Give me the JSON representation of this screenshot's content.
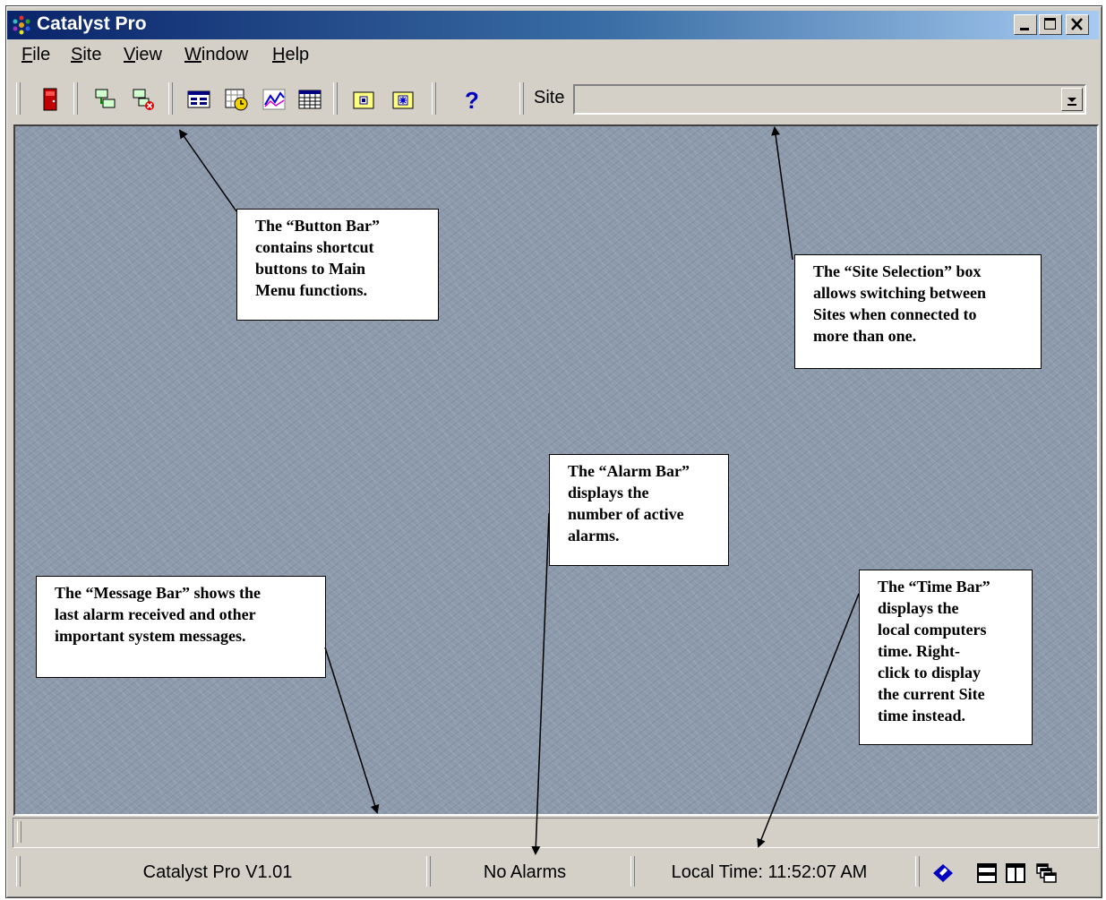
{
  "window": {
    "title": "Catalyst Pro"
  },
  "menu": {
    "items": [
      {
        "label": "File"
      },
      {
        "label": "Site"
      },
      {
        "label": "View"
      },
      {
        "label": "Window"
      },
      {
        "label": "Help"
      }
    ]
  },
  "toolbar": {
    "site_label": "Site",
    "site_value": ""
  },
  "callouts": {
    "button_bar": [
      "The “Button Bar”",
      "contains shortcut",
      "buttons to Main",
      "Menu functions."
    ],
    "site_selection": [
      "The “Site Selection” box",
      "allows switching between",
      "Sites when connected to",
      "more than one."
    ],
    "alarm_bar": [
      "The “Alarm Bar”",
      "displays the",
      "number of active",
      "alarms."
    ],
    "message_bar": [
      "The “Message Bar” shows the",
      "last alarm received and other",
      "important system messages."
    ],
    "time_bar": [
      "The “Time Bar”",
      "displays the",
      "local computers",
      "time. Right-",
      "click to display",
      "the current Site",
      "time instead."
    ]
  },
  "statusbar": {
    "version": "Catalyst Pro V1.01",
    "alarms": "No Alarms",
    "time": "Local Time: 11:52:07 AM"
  },
  "colors": {
    "titlebar_start": "#0a246a",
    "titlebar_end": "#a6caf0",
    "workspace": "#8c9aab"
  }
}
